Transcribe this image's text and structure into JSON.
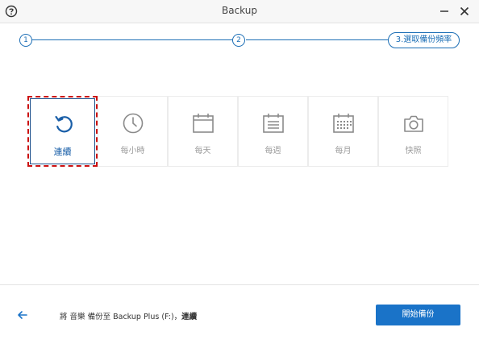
{
  "window": {
    "title": "Backup"
  },
  "steps": [
    {
      "label": "1"
    },
    {
      "label": "2"
    },
    {
      "label": "3.選取備份頻率"
    }
  ],
  "options": [
    {
      "label": "連續",
      "icon": "refresh-icon",
      "selected": true
    },
    {
      "label": "每小時",
      "icon": "clock-icon",
      "selected": false
    },
    {
      "label": "每天",
      "icon": "calendar-day-icon",
      "selected": false
    },
    {
      "label": "每週",
      "icon": "calendar-week-icon",
      "selected": false
    },
    {
      "label": "每月",
      "icon": "calendar-month-icon",
      "selected": false
    },
    {
      "label": "快照",
      "icon": "camera-icon",
      "selected": false
    }
  ],
  "footer": {
    "summary_prefix": "將",
    "summary_source": "音樂",
    "summary_mid": "備份至 Backup Plus (F:)，",
    "summary_frequency": "連續",
    "start_button": "開始備份"
  },
  "colors": {
    "accent": "#1a73c8",
    "step": "#1a6db5",
    "selection_border": "#cc1111",
    "icon_gray": "#8a8a8a"
  }
}
